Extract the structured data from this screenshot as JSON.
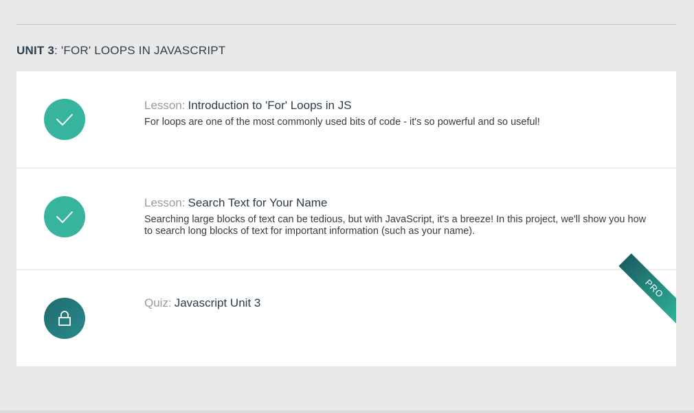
{
  "unit": {
    "label": "UNIT 3",
    "separator": ":",
    "title": "'FOR' LOOPS IN JAVASCRIPT"
  },
  "items": [
    {
      "type_label": "Lesson:",
      "title": "Introduction to 'For' Loops in JS",
      "description": "For loops are one of the most commonly used bits of code - it's so powerful and so useful!",
      "status": "completed",
      "icon": "check-icon"
    },
    {
      "type_label": "Lesson:",
      "title": "Search Text for Your Name",
      "description": "Searching large blocks of text can be tedious, but with JavaScript, it's a breeze! In this project, we'll show you how to search long blocks of text for important information (such as your name).",
      "status": "completed",
      "icon": "check-icon"
    },
    {
      "type_label": "Quiz:",
      "title": "Javascript Unit 3",
      "description": "",
      "status": "locked",
      "icon": "lock-icon",
      "badge": "PRO"
    }
  ],
  "colors": {
    "completed": "#37b49e",
    "locked": "#1f6b6f",
    "heading": "#2f3e4c",
    "type_label": "#9a9a9a"
  }
}
